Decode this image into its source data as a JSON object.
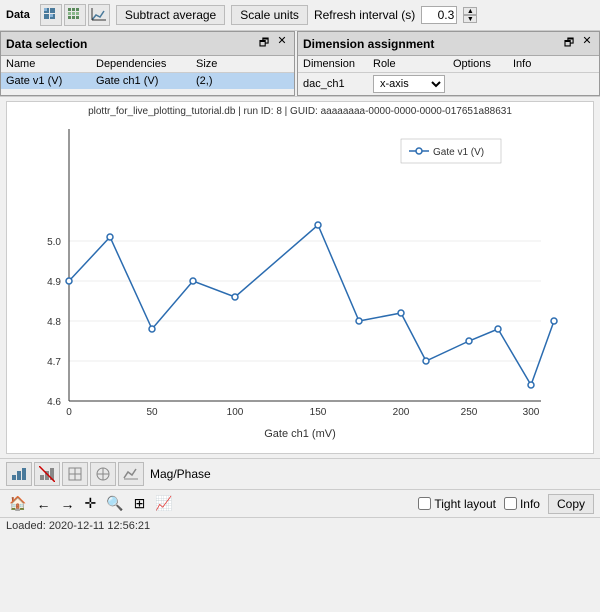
{
  "toolbar": {
    "title": "Data",
    "subtract_avg_label": "Subtract average",
    "scale_units_label": "Scale units",
    "refresh_label": "Refresh interval (s)",
    "refresh_value": "0.3",
    "icon1": "grid-icon",
    "icon2": "grid2-icon",
    "icon3": "chart-icon"
  },
  "data_selection": {
    "title": "Data selection",
    "columns": [
      "Name",
      "Dependencies",
      "Size"
    ],
    "rows": [
      {
        "name": "Gate v1 (V)",
        "dependency": "Gate ch1 (V)",
        "size": "(2,)"
      }
    ]
  },
  "dimension_assignment": {
    "title": "Dimension assignment",
    "columns": [
      "Dimension",
      "Role",
      "Options",
      "Info"
    ],
    "rows": [
      {
        "dimension": "dac_ch1",
        "role": "x-axis"
      }
    ]
  },
  "chart": {
    "subtitle": "plottr_for_live_plotting_tutorial.db | run ID: 8 | GUID: aaaaaaaa-0000-0000-0000-017651a88631",
    "x_label": "Gate ch1 (mV)",
    "y_label": "",
    "legend_label": "Gate v1 (V)",
    "x_ticks": [
      "0",
      "50",
      "100",
      "150",
      "200",
      "250",
      "300"
    ],
    "y_ticks": [
      "4.6",
      "4.7",
      "4.8",
      "4.9",
      "5.0"
    ]
  },
  "bottom_toolbar": {
    "mag_phase_label": "Mag/Phase",
    "icons": [
      "plot-icon",
      "back-plot-icon",
      "icon3",
      "icon4",
      "icon5"
    ]
  },
  "nav": {
    "icons": [
      "home-icon",
      "back-icon",
      "forward-icon",
      "move-icon",
      "zoom-icon",
      "settings-icon",
      "export-icon"
    ],
    "tight_layout_label": "Tight layout",
    "info_label": "Info",
    "copy_label": "Copy"
  },
  "status": {
    "text": "Loaded: 2020-12-11 12:56:21"
  }
}
